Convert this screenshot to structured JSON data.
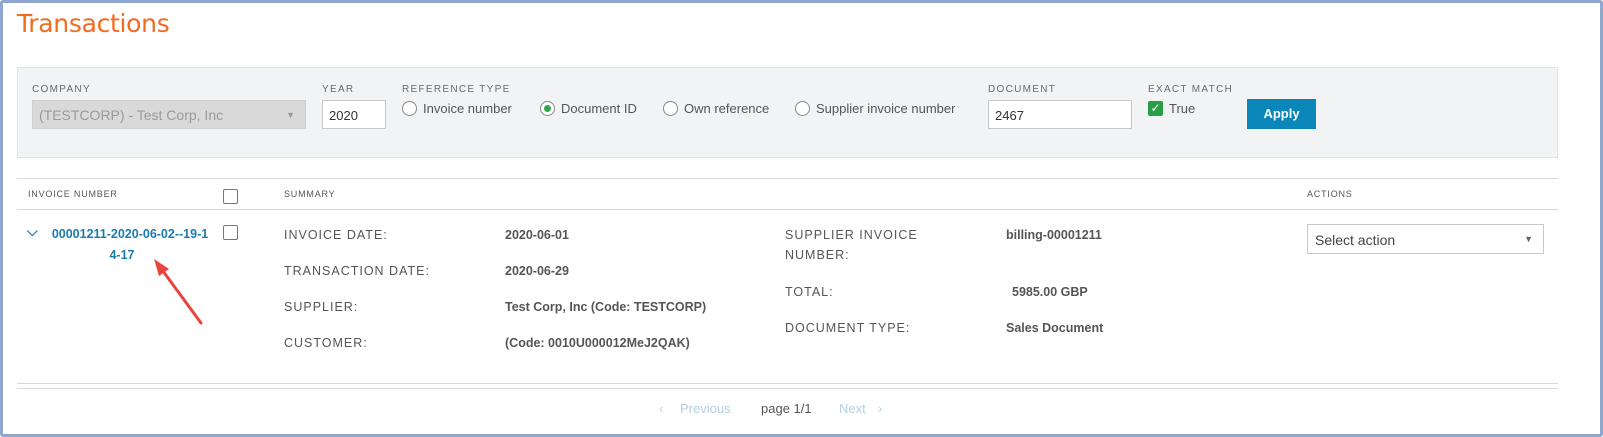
{
  "page": {
    "title": "Transactions"
  },
  "filters": {
    "company_label": "COMPANY",
    "company_value": "(TESTCORP) - Test Corp, Inc",
    "year_label": "YEAR",
    "year_value": "2020",
    "reference_type_label": "REFERENCE TYPE",
    "reference_types": [
      {
        "label": "Invoice number",
        "selected": false
      },
      {
        "label": "Document ID",
        "selected": true
      },
      {
        "label": "Own reference",
        "selected": false
      },
      {
        "label": "Supplier invoice number",
        "selected": false
      }
    ],
    "document_label": "DOCUMENT",
    "document_value": "2467",
    "exact_match_label": "EXACT MATCH",
    "exact_match_value": "True",
    "exact_match_checked": true,
    "apply_label": "Apply"
  },
  "table": {
    "headers": {
      "invoice_number": "INVOICE NUMBER",
      "summary": "SUMMARY",
      "actions": "ACTIONS"
    },
    "row": {
      "invoice_number_line1": "00001211-2020-06-02--19-1",
      "invoice_number_line2": "4-17",
      "invoice_date_label": "INVOICE DATE:",
      "invoice_date": "2020-06-01",
      "transaction_date_label": "TRANSACTION DATE:",
      "transaction_date": "2020-06-29",
      "supplier_label": "SUPPLIER:",
      "supplier": "Test Corp, Inc (Code: TESTCORP)",
      "customer_label": "CUSTOMER:",
      "customer": "(Code: 0010U000012MeJ2QAK)",
      "supplier_invoice_number_label_line1": "SUPPLIER INVOICE",
      "supplier_invoice_number_label_line2": "NUMBER:",
      "supplier_invoice_number": "billing-00001211",
      "total_label": "TOTAL:",
      "total": "5985.00 GBP",
      "document_type_label": "DOCUMENT TYPE:",
      "document_type": "Sales Document",
      "action_placeholder": "Select action"
    }
  },
  "pagination": {
    "previous": "Previous",
    "page": "page 1/1",
    "next": "Next"
  },
  "colors": {
    "title": "#f36b21",
    "link": "#1b7bb0",
    "apply": "#0a86b8",
    "check": "#2a9d47",
    "annotation_arrow": "#e8453c"
  }
}
